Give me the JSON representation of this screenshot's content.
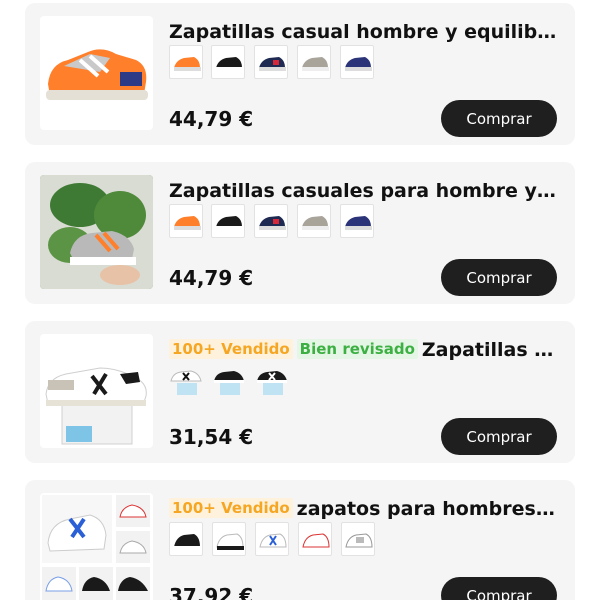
{
  "products": [
    {
      "title": "Zapatillas casual hombre y equilibrador de movimiento a la moda",
      "badges": [],
      "price": "44,79 €",
      "buy_label": "Comprar",
      "variant_colors": [
        "orange-grey",
        "black-white",
        "navy-red",
        "grey-beige",
        "navy-blue"
      ]
    },
    {
      "title": "Zapatillas casuales para hombre y equilibrio de moda",
      "badges": [],
      "price": "44,79 €",
      "buy_label": "Comprar",
      "variant_colors": [
        "orange-grey",
        "black-white",
        "navy-red",
        "grey-beige",
        "navy-blue"
      ]
    },
    {
      "title": "Zapatillas deportivas blancas",
      "badges": [
        {
          "text": "100+ Vendido",
          "type": "sold"
        },
        {
          "text": "Bien revisado",
          "type": "checked"
        }
      ],
      "price": "31,54 €",
      "buy_label": "Comprar",
      "variant_colors": [
        "white-light-blue",
        "black-white",
        "black-white"
      ]
    },
    {
      "title": "zapatos para hombres zapatillas de deporte",
      "badges": [
        {
          "text": "100+ Vendido",
          "type": "sold"
        }
      ],
      "price": "37,92 €",
      "buy_label": "Comprar",
      "variant_colors": [
        "black",
        "white",
        "white-blue",
        "white-red",
        "white-grey"
      ]
    }
  ],
  "colors": {
    "card_bg": "#f5f5f5",
    "button_bg": "#1f1f1f",
    "sold_badge": "#f5a623",
    "checked_badge": "#3cb043"
  }
}
